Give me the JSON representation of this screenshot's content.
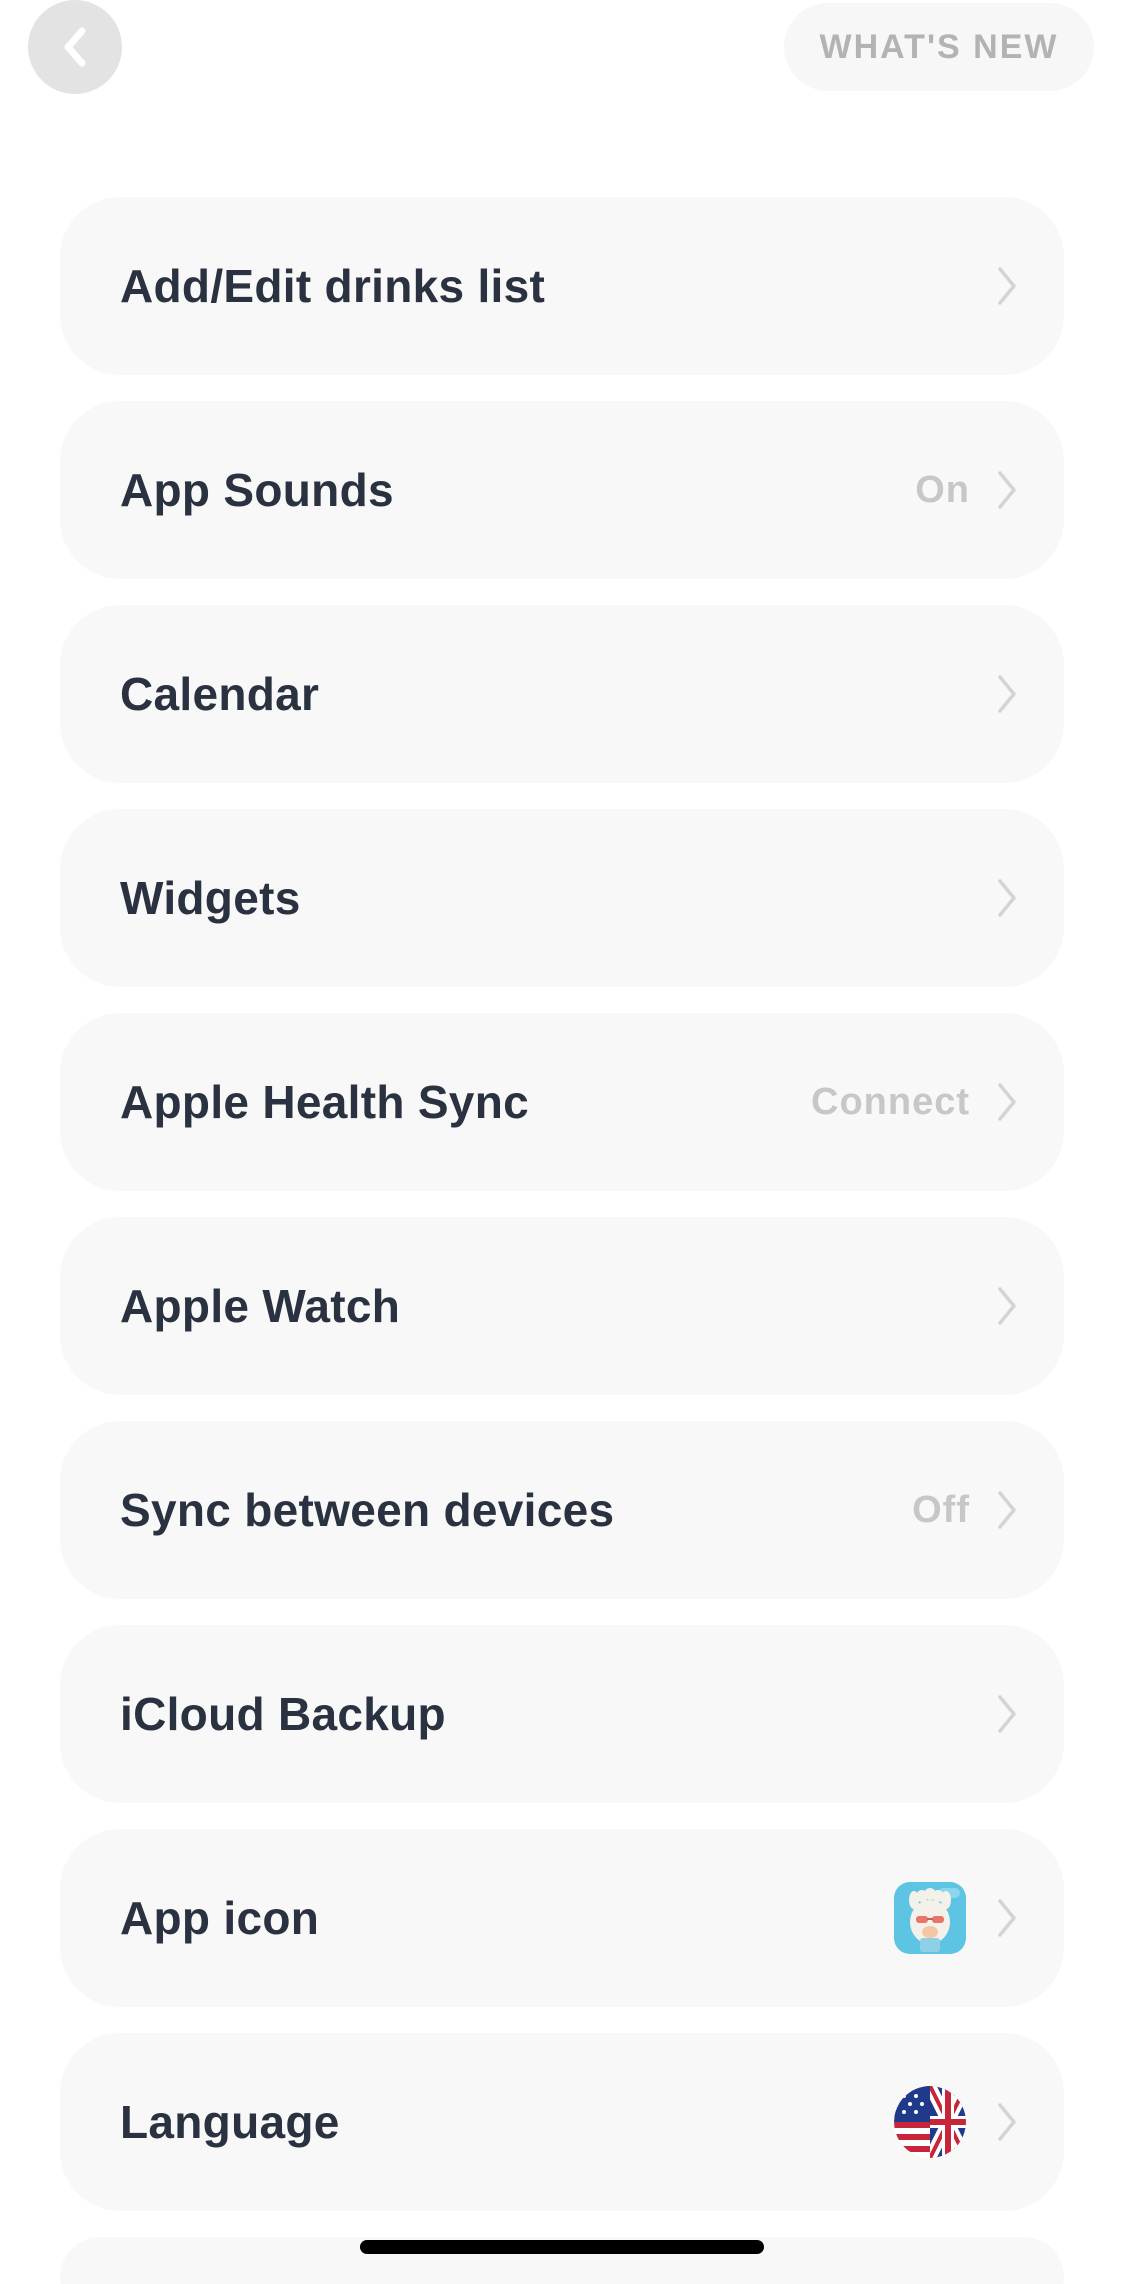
{
  "header": {
    "whats_new_label": "WHAT'S NEW"
  },
  "settings": {
    "items": [
      {
        "label": "Add/Edit drinks list",
        "value": ""
      },
      {
        "label": "App Sounds",
        "value": "On"
      },
      {
        "label": "Calendar",
        "value": ""
      },
      {
        "label": "Widgets",
        "value": ""
      },
      {
        "label": "Apple Health Sync",
        "value": "Connect"
      },
      {
        "label": "Apple Watch",
        "value": ""
      },
      {
        "label": "Sync between devices",
        "value": "Off"
      },
      {
        "label": "iCloud Backup",
        "value": ""
      },
      {
        "label": "App icon",
        "value": ""
      },
      {
        "label": "Language",
        "value": ""
      }
    ]
  },
  "icons": {
    "back": "chevron-left-icon",
    "row_arrow": "chevron-right-icon",
    "app_icon": "llama-app-icon",
    "language_flag": "us-uk-flag-icon"
  },
  "colors": {
    "row_background": "#f8f8f8",
    "label_text": "#2a3140",
    "muted_value": "#c7c7c9",
    "back_button_bg": "#e3e3e4"
  }
}
